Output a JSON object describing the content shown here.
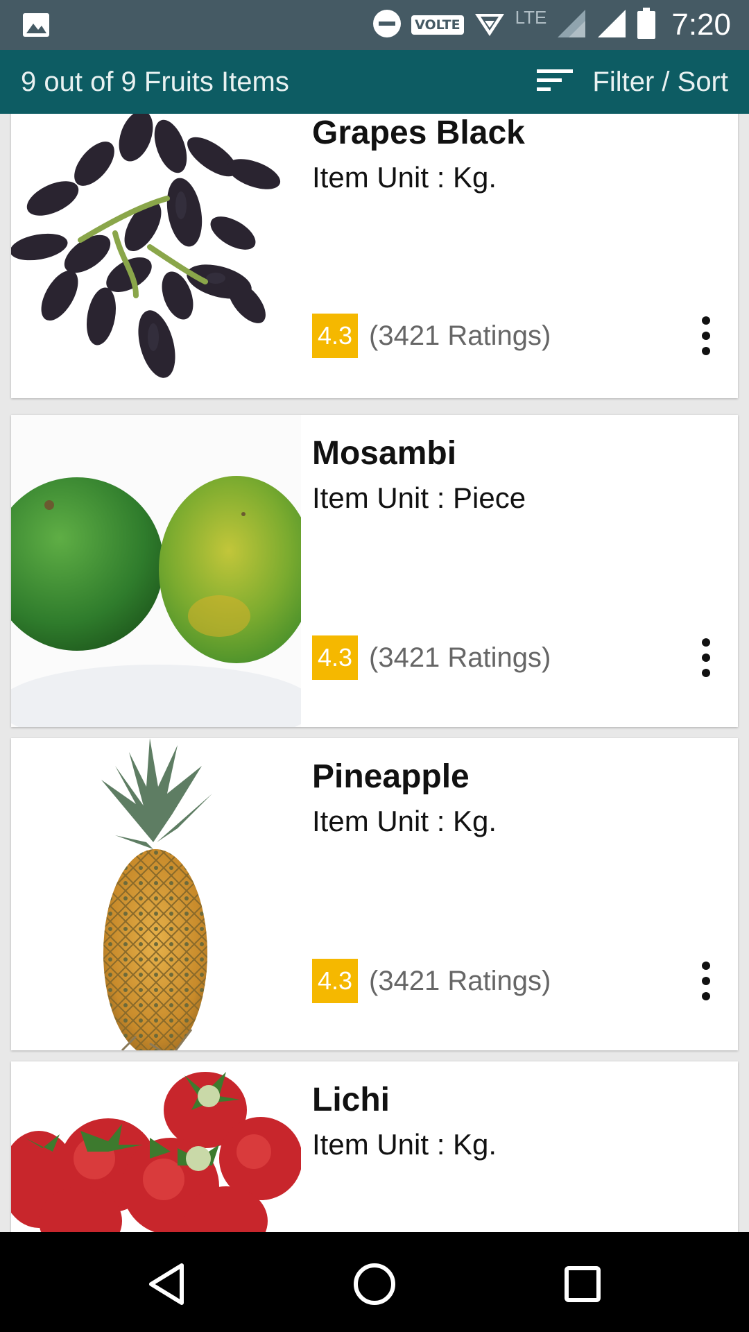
{
  "status_bar": {
    "time": "7:20",
    "volte_label": "VOLTE",
    "lte_label": "LTE",
    "icons": [
      "image-icon",
      "do-not-disturb-icon",
      "volte-icon",
      "data-signal-icon",
      "cell-signal-icon",
      "battery-icon"
    ]
  },
  "app_bar": {
    "title": "9 out of 9 Fruits Items",
    "filter_label": "Filter / Sort",
    "filter_icon": "sort-lines-icon"
  },
  "items": [
    {
      "name": "Grapes Black",
      "unit": "Item Unit : Kg.",
      "rating": "4.3",
      "ratings_count": "(3421 Ratings)",
      "image": "black-grapes"
    },
    {
      "name": "Mosambi",
      "unit": "Item Unit : Piece",
      "rating": "4.3",
      "ratings_count": "(3421 Ratings)",
      "image": "mosambi"
    },
    {
      "name": "Pineapple",
      "unit": "Item Unit : Kg.",
      "rating": "4.3",
      "ratings_count": "(3421 Ratings)",
      "image": "pineapple"
    },
    {
      "name": "Lichi",
      "unit": "Item Unit : Kg.",
      "rating": "",
      "ratings_count": "",
      "image": "strawberries"
    }
  ],
  "colors": {
    "status_bar": "#455a64",
    "app_bar": "#0d5c63",
    "rating_badge": "#f5b800"
  },
  "nav_bar": {
    "icons": [
      "back-triangle-icon",
      "home-circle-icon",
      "recents-square-icon"
    ]
  }
}
